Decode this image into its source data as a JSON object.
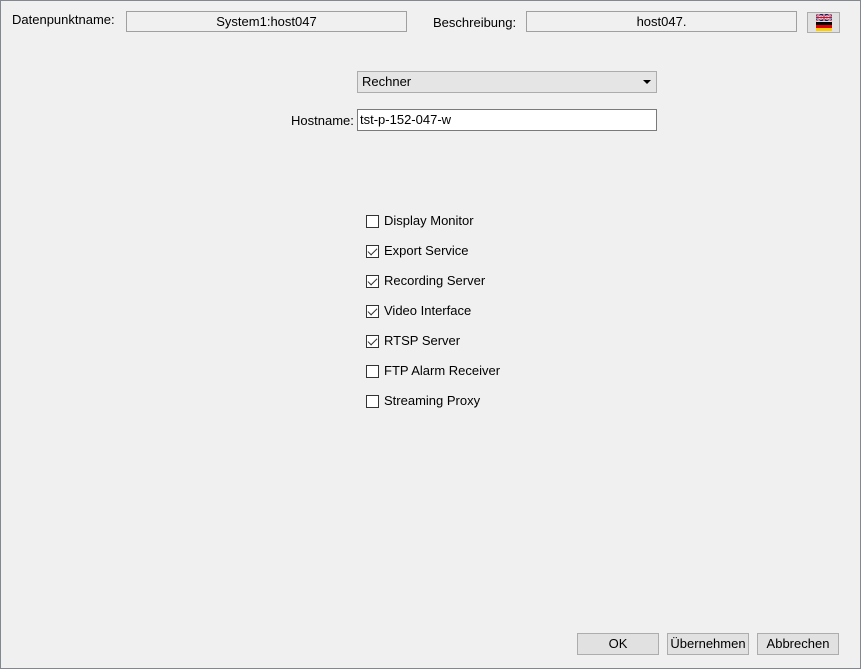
{
  "header": {
    "datapoint_label": "Datenpunktname:",
    "datapoint_value": "System1:host047",
    "description_label": "Beschreibung:",
    "description_value": "host047."
  },
  "language_button": {
    "icon": "flag-icon"
  },
  "type_select": {
    "selected": "Rechner"
  },
  "hostname": {
    "label": "Hostname:",
    "value": "tst-p-152-047-w"
  },
  "services": [
    {
      "label": "Display Monitor",
      "checked": false
    },
    {
      "label": "Export Service",
      "checked": true
    },
    {
      "label": "Recording Server",
      "checked": true
    },
    {
      "label": "Video Interface",
      "checked": true
    },
    {
      "label": "RTSP Server",
      "checked": true
    },
    {
      "label": "FTP Alarm Receiver",
      "checked": false
    },
    {
      "label": "Streaming Proxy",
      "checked": false
    }
  ],
  "buttons": {
    "ok": "OK",
    "apply": "Übernehmen",
    "cancel": "Abbrechen"
  },
  "colors": {
    "background": "#f0f0f0",
    "button_face": "#e1e1e1",
    "field_border": "#a0a0a0"
  }
}
